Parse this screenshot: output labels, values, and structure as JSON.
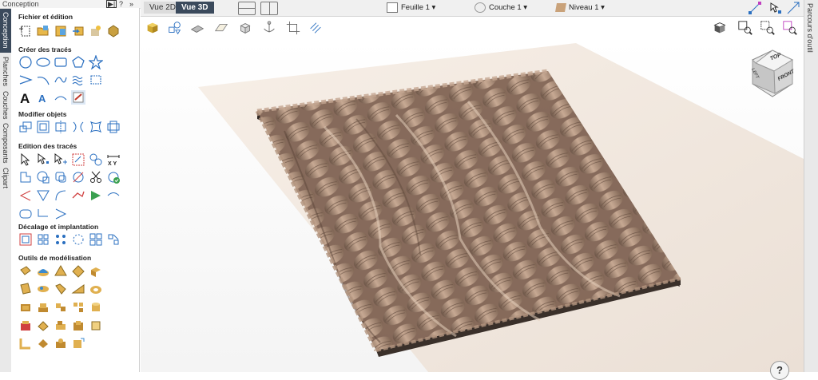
{
  "panel": {
    "title": "Conception",
    "controls": {
      "pin": "▶|",
      "help": "?",
      "close": "»"
    }
  },
  "left_tabs": [
    "Conception",
    "Planches",
    "Couches",
    "Composants",
    "Clipart"
  ],
  "sections": {
    "fichier": "Fichier et édition",
    "creer": "Créer des tracés",
    "modifier": "Modifier objets",
    "edition": "Edition des tracés",
    "decalage": "Décalage et implantation",
    "outils": "Outils de modélisation"
  },
  "top": {
    "vue2d": "Vue 2D",
    "vue3d": "Vue 3D",
    "feuille": "Feuille 1",
    "couche": "Couche 1",
    "niveau": "Niveau 1"
  },
  "right_tab": "Parcours d'outil",
  "viewcube": {
    "top": "TOP",
    "front": "FRONT",
    "left": "LEFT"
  },
  "help_label": "?",
  "colors": {
    "accent": "#3b4a5c",
    "relief": "#b89a84",
    "sheet": "#f0e6dd"
  }
}
